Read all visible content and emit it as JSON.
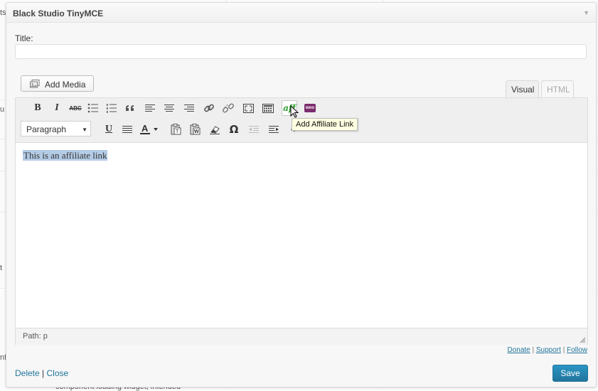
{
  "background": {
    "fragments": [
      "ts",
      "u",
      "nf",
      "t",
      "component loading widget, intended"
    ]
  },
  "widget": {
    "title": "Black Studio TinyMCE",
    "title_field_label": "Title:",
    "title_value": "",
    "add_media_label": "Add Media",
    "tabs": {
      "visual": "Visual",
      "html": "HTML"
    },
    "toolbar": {
      "row1": [
        "bold-icon",
        "italic-icon",
        "strikethrough-icon",
        "bullet-list-icon",
        "numbered-list-icon",
        "blockquote-icon",
        "align-left-icon",
        "align-center-icon",
        "align-right-icon",
        "link-icon",
        "unlink-icon",
        "fullscreen-icon",
        "kitchen-sink-icon",
        "affiliate-icon",
        "woo-icon"
      ],
      "row2": [
        "underline-icon",
        "justify-icon",
        "text-color-icon",
        "paste-text-icon",
        "paste-word-icon",
        "clear-format-icon",
        "special-char-icon",
        "outdent-icon",
        "indent-icon",
        "undo-icon"
      ],
      "bold_glyph": "B",
      "italic_glyph": "I",
      "strike_glyph": "ABC",
      "underline_glyph": "U",
      "omega_glyph": "Ω",
      "aff_glyph": "aff",
      "woo_glyph": "woo",
      "format_select": "Paragraph"
    },
    "tooltip": "Add Affiliate Link",
    "content_text": "This is an affiliate link",
    "path": "Path: p"
  },
  "footer": {
    "links": [
      "Donate",
      "Support",
      "Follow"
    ],
    "separator": "|",
    "delete": "Delete",
    "close": "Close",
    "save": "Save"
  },
  "colors": {
    "link": "#21759b",
    "save_button": "#2a95c5",
    "selection": "#b4cbe5",
    "tooltip_bg": "#ffffe1",
    "affiliate_green": "#2e9e2e",
    "woo_purple": "#7b2c6c"
  }
}
